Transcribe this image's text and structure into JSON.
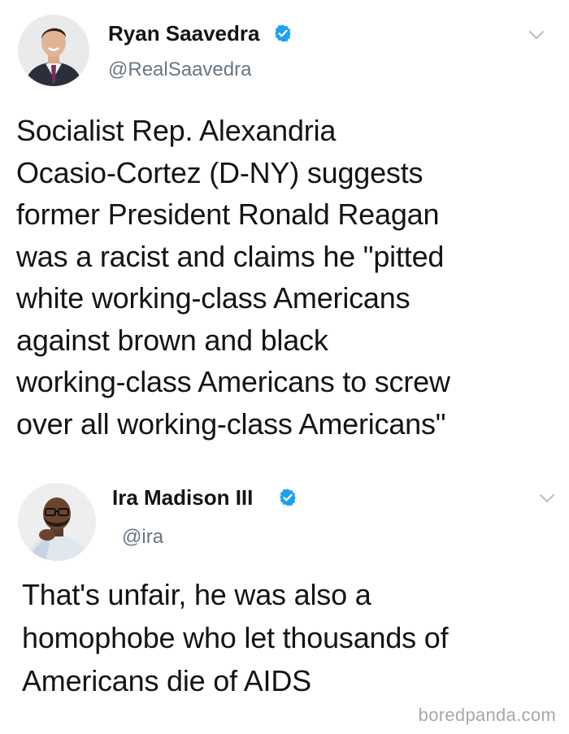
{
  "tweets": [
    {
      "author_name": "Ryan Saavedra",
      "handle": "@RealSaavedra",
      "verified": true,
      "text": "Socialist Rep. Alexandria\nOcasio-Cortez (D-NY) suggests\nformer President Ronald Reagan\nwas a racist and claims he \"pitted\nwhite working-class Americans\nagainst brown and black\nworking-class Americans to screw\nover all working-class Americans\""
    },
    {
      "author_name": "Ira Madison III",
      "handle": "@ira",
      "verified": true,
      "text": "That's unfair, he was also a\nhomophobe who let thousands of\nAmericans die of AIDS"
    }
  ],
  "watermark": "boredpanda.com",
  "colors": {
    "verified": "#1da1f2",
    "handle": "#657786",
    "text": "#141414"
  },
  "icons": {
    "verified": "verified-badge-icon",
    "menu": "chevron-down-icon"
  }
}
